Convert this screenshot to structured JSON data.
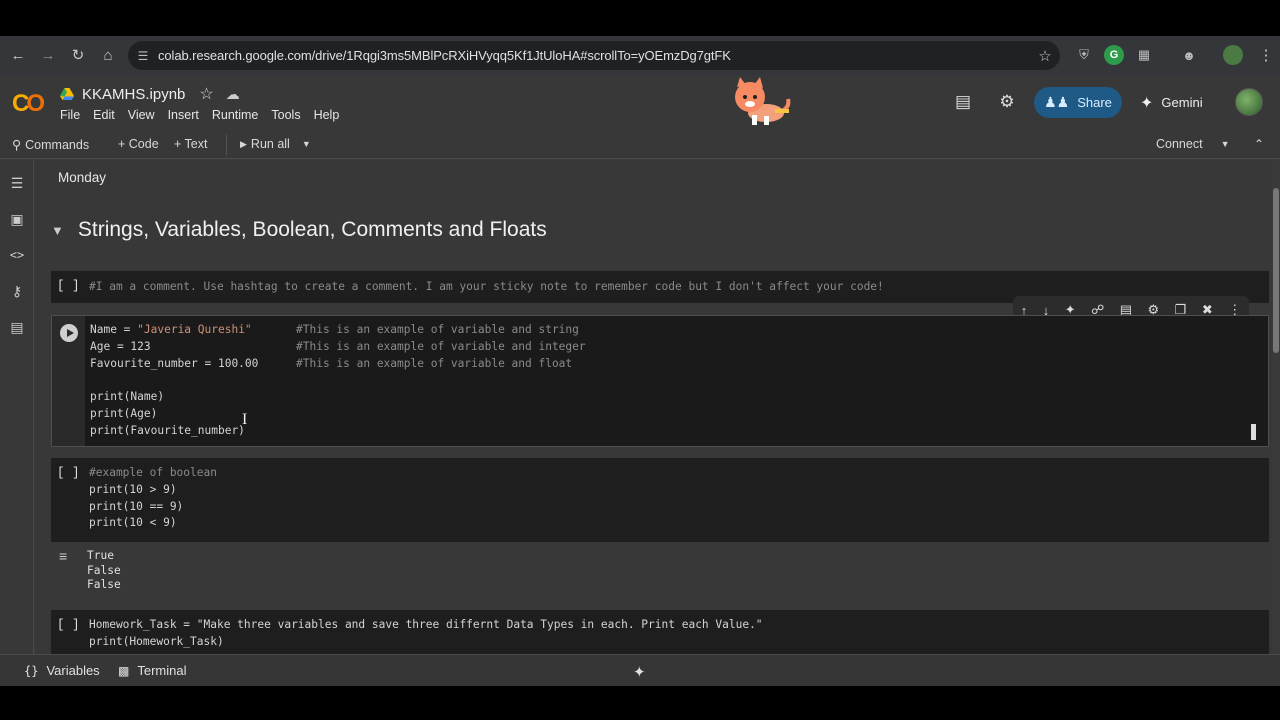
{
  "browser": {
    "url": "colab.research.google.com/drive/1Rqgi3ms5MBlPcRXiHVyqq5Kf1JtUloHA#scrollTo=yOEmzDg7gtFK"
  },
  "header": {
    "notebook_title": "KKAMHS.ipynb",
    "menu": [
      "File",
      "Edit",
      "View",
      "Insert",
      "Runtime",
      "Tools",
      "Help"
    ],
    "share_label": "Share",
    "gemini_label": "Gemini"
  },
  "toolbar": {
    "commands_label": "Commands",
    "code_label": "+ Code",
    "text_label": "+ Text",
    "run_all_label": "Run all",
    "connect_label": "Connect"
  },
  "content": {
    "section_label": "Monday",
    "heading": "Strings, Variables, Boolean, Comments and Floats",
    "cell1": {
      "brackets": "[ ]",
      "line": "#I am a comment. Use hashtag to create a comment. I am your sticky note to remember code but I don't affect your code!"
    },
    "cell2": {
      "lines": [
        "Name = \"Javeria Qureshi\"",
        "Age = 123",
        "Favourite_number = 100.00",
        "",
        "print(Name)",
        "print(Age)",
        "print(Favourite_number)"
      ],
      "comments": [
        "#This is an example of variable and string",
        "#This is an example of variable and integer",
        "#This is an example of variable and float"
      ]
    },
    "cell3": {
      "brackets": "[ ]",
      "lines": [
        "#example of boolean",
        "print(10 > 9)",
        "print(10 == 9)",
        "print(10 < 9)"
      ],
      "output": [
        "True",
        "False",
        "False"
      ]
    },
    "cell4": {
      "brackets": "[ ]",
      "lines": [
        "Homework_Task = \"Make three variables and save three differnt Data Types in each. Print each Value.\"",
        "print(Homework_Task)"
      ]
    }
  },
  "statusbar": {
    "variables_label": "Variables",
    "terminal_label": "Terminal"
  },
  "colors": {
    "string": "#ce9178",
    "number": "#b5cea8",
    "comment": "#6a9955",
    "share_bg": "#1f5a87"
  }
}
